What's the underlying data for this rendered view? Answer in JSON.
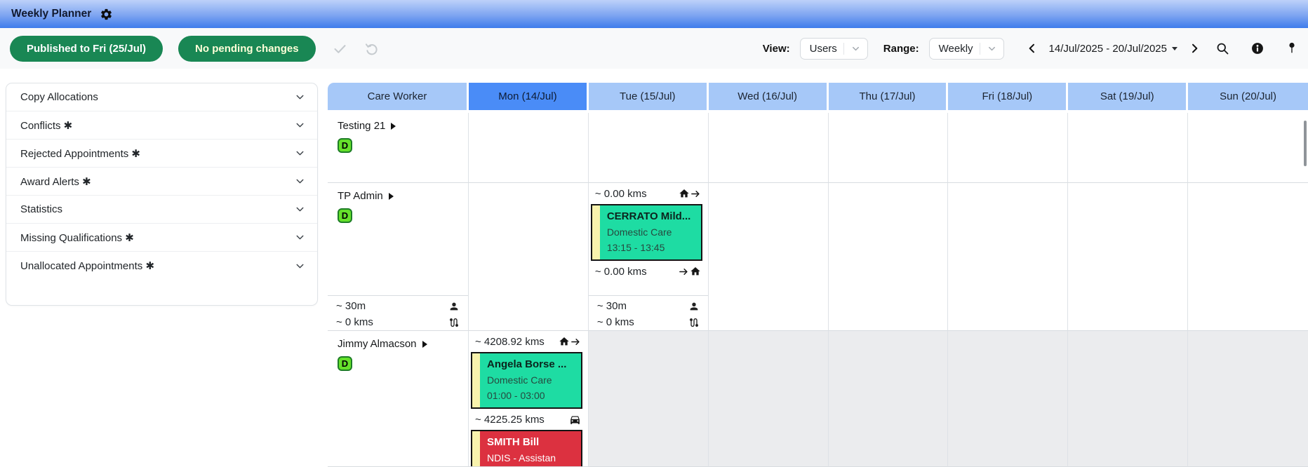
{
  "titlebar": {
    "title": "Weekly Planner"
  },
  "toolbar": {
    "published_label": "Published to Fri (25/Jul)",
    "pending_label": "No pending changes",
    "view_label": "View:",
    "view_value": "Users",
    "range_label": "Range:",
    "range_value": "Weekly",
    "date_range": "14/Jul/2025 - 20/Jul/2025"
  },
  "sidebar": {
    "items": [
      {
        "label": "Copy Allocations"
      },
      {
        "label": "Conflicts ✱"
      },
      {
        "label": "Rejected Appointments ✱"
      },
      {
        "label": "Award Alerts ✱"
      },
      {
        "label": "Statistics"
      },
      {
        "label": "Missing Qualifications ✱"
      },
      {
        "label": "Unallocated Appointments ✱"
      }
    ]
  },
  "calendar": {
    "headers": [
      "Care Worker",
      "Mon (14/Jul)",
      "Tue (15/Jul)",
      "Wed (16/Jul)",
      "Thu (17/Jul)",
      "Fri (18/Jul)",
      "Sat (19/Jul)",
      "Sun (20/Jul)"
    ],
    "active_header": "Mon (14/Jul)",
    "rows": [
      {
        "worker": "Testing 21",
        "badge": "D"
      },
      {
        "worker": "TP Admin",
        "badge": "D",
        "worker_stats": {
          "time": "~ 30m",
          "distance": "~ 0 kms"
        },
        "tue": {
          "travel_before": "~ 0.00 kms",
          "appointment": {
            "title": "CERRATO Mild...",
            "service": "Domestic Care",
            "time": "13:15 - 13:45"
          },
          "travel_after": "~ 0.00 kms",
          "stats": {
            "time": "~ 30m",
            "distance": "~ 0 kms"
          }
        }
      },
      {
        "worker": "Jimmy Almacson",
        "badge": "D",
        "mon": {
          "travel_before": "~ 4208.92 kms",
          "appointment1": {
            "title": "Angela Borse ...",
            "service": "Domestic Care",
            "time": "01:00 - 03:00"
          },
          "travel_between": "~ 4225.25 kms",
          "appointment2": {
            "title": "SMITH Bill",
            "service": "NDIS - Assistan"
          }
        }
      }
    ]
  },
  "colors": {
    "header_blue": "#a6c8f8",
    "header_active_blue": "#4a8cf7",
    "button_green": "#198754",
    "appointment_teal": "#1edca3",
    "appointment_red": "#dc3140",
    "appointment_stripe_yellow": "#f8f3ad",
    "badge_green": "#65e12b"
  }
}
